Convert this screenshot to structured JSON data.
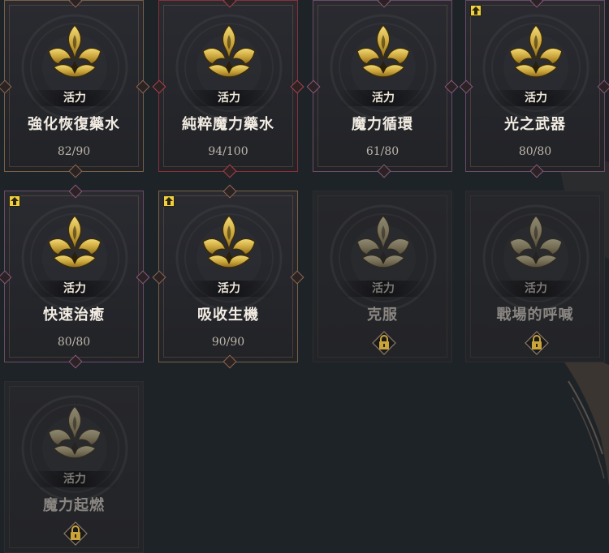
{
  "skills": [
    {
      "category": "活力",
      "name": "強化恢復藥水",
      "count": "82/90",
      "style": "bronze",
      "upgrade": false,
      "locked": false
    },
    {
      "category": "活力",
      "name": "純粹魔力藥水",
      "count": "94/100",
      "style": "red",
      "upgrade": false,
      "locked": false
    },
    {
      "category": "活力",
      "name": "魔力循環",
      "count": "61/80",
      "style": "purple",
      "upgrade": false,
      "locked": false
    },
    {
      "category": "活力",
      "name": "光之武器",
      "count": "80/80",
      "style": "purple",
      "upgrade": true,
      "locked": false
    },
    {
      "category": "活力",
      "name": "快速治癒",
      "count": "80/80",
      "style": "purple",
      "upgrade": true,
      "locked": false
    },
    {
      "category": "活力",
      "name": "吸收生機",
      "count": "90/90",
      "style": "bronze",
      "upgrade": true,
      "locked": false
    },
    {
      "category": "活力",
      "name": "克服",
      "count": "",
      "style": "locked",
      "upgrade": false,
      "locked": true
    },
    {
      "category": "活力",
      "name": "戰場的呼喊",
      "count": "",
      "style": "locked",
      "upgrade": false,
      "locked": true
    },
    {
      "category": "活力",
      "name": "魔力起燃",
      "count": "",
      "style": "locked",
      "upgrade": false,
      "locked": true
    }
  ],
  "icons": {
    "emblem": "vitality-lotus-icon",
    "upgrade": "upgrade-arrow-icon",
    "lock": "padlock-icon"
  },
  "colors": {
    "gold": "#c9a43a",
    "gold_light": "#f0d66a",
    "upgrade_badge": "#f0d040"
  }
}
